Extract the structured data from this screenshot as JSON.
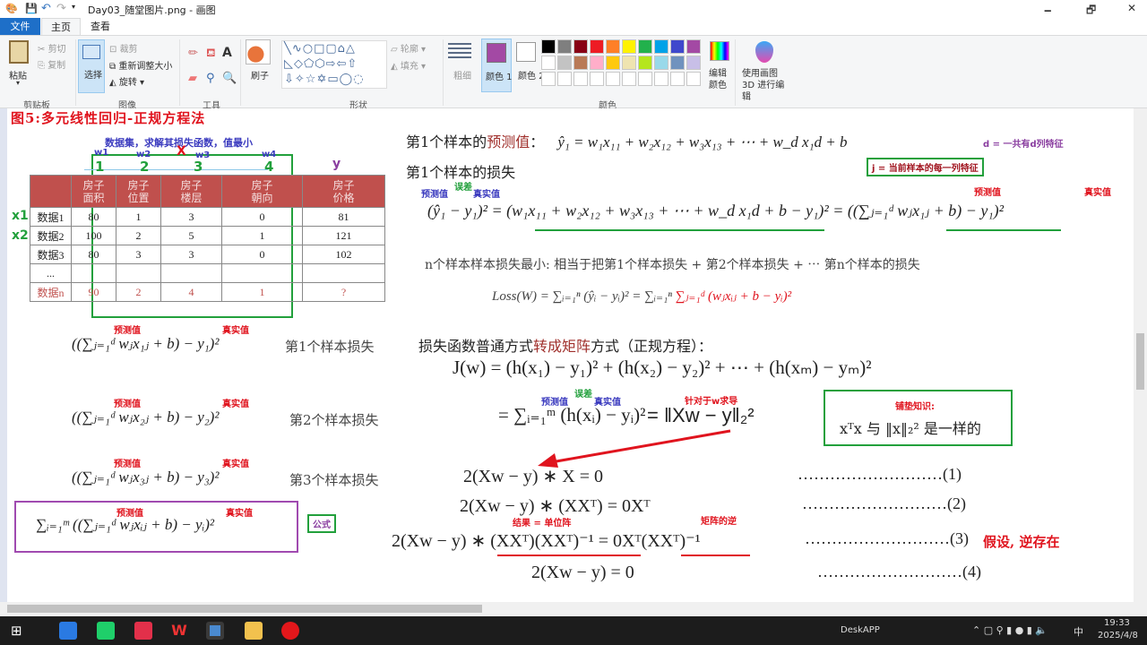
{
  "window": {
    "title": "Day03_随堂图片.png - 画图",
    "minimize": "🗕",
    "maximize": "🗗",
    "close": "✕"
  },
  "tabs": [
    {
      "label": "文件"
    },
    {
      "label": "主页"
    },
    {
      "label": "查看"
    }
  ],
  "ribbon": {
    "clipboard": {
      "paste": "粘贴",
      "cut": "剪切",
      "copy": "复制",
      "group": "剪贴板"
    },
    "image": {
      "select": "选择",
      "crop": "裁剪",
      "resize": "重新调整大小",
      "rotate": "旋转",
      "group": "图像"
    },
    "tools": {
      "group": "工具"
    },
    "brush": {
      "label": "刷子"
    },
    "shapes": {
      "outline": "轮廓",
      "fill": "填充",
      "group": "形状"
    },
    "size": {
      "label": "粗细"
    },
    "color1": {
      "label": "颜色 1",
      "value": "#a349a4"
    },
    "color2": {
      "label": "颜色 2",
      "value": "#ffffff"
    },
    "colors": {
      "group": "颜色",
      "edit": "编辑颜色",
      "row1": [
        "#000000",
        "#7f7f7f",
        "#880015",
        "#ed1c24",
        "#ff7f27",
        "#fff200",
        "#22b14c",
        "#00a2e8",
        "#3f48cc",
        "#a349a4"
      ],
      "row2": [
        "#ffffff",
        "#c3c3c3",
        "#b97a57",
        "#ffaec9",
        "#ffc90e",
        "#efe4b0",
        "#b5e61d",
        "#99d9ea",
        "#7092be",
        "#c8bfe7"
      ]
    },
    "paint3d": "使用画图 3D 进行编辑"
  },
  "doc": {
    "title": "图5:多元线性回归-正规方程法",
    "dataset_note": "数据集，求解其损失函数，值最小",
    "weights": [
      "w1",
      "w2",
      "w3",
      "w4"
    ],
    "col_nums": [
      "1",
      "2",
      "3",
      "4"
    ],
    "x_mark": "X",
    "y_label": "y",
    "row_labels": [
      "x1",
      "x2"
    ],
    "table": {
      "headers": [
        "",
        "房子\n面积",
        "房子\n位置",
        "房子\n楼层",
        "房子\n朝向",
        "房子\n价格"
      ],
      "rows": [
        [
          "数据1",
          "80",
          "1",
          "3",
          "0",
          "81"
        ],
        [
          "数据2",
          "100",
          "2",
          "5",
          "1",
          "121"
        ],
        [
          "数据3",
          "80",
          "3",
          "3",
          "0",
          "102"
        ],
        [
          "...",
          "",
          "",
          "",
          "",
          ""
        ],
        [
          "数据n",
          "90",
          "2",
          "4",
          "1",
          "?"
        ]
      ]
    },
    "pred": "预测值",
    "true": "真实值",
    "err": "误差",
    "left_eqs": [
      {
        "eq": "((∑ⱼ₌₁ᵈ wⱼx₁ⱼ + b)  − y₁)²",
        "note": "第1个样本损失"
      },
      {
        "eq": "((∑ⱼ₌₁ᵈ wⱼx₂ⱼ + b)  − y₂)²",
        "note": "第2个样本损失"
      },
      {
        "eq": "((∑ⱼ₌₁ᵈ wⱼx₃ⱼ + b)  − y₃)²",
        "note": "第3个样本损失"
      }
    ],
    "formula_eq": "∑ᵢ₌₁ᵐ ((∑ⱼ₌₁ᵈ wⱼxᵢⱼ + b)  − yᵢ)²",
    "formula_tag": "公式",
    "pred_line_label": "第1个样本的",
    "pred_line_label_red": "预测值",
    "pred_line_colon": "：",
    "pred_eq": "ŷ₁ = w₁x₁₁ + w₂x₁₂ + w₃x₁₃ + ⋯ + w_d x₁d  + b",
    "d_note": "d = 一共有d列特征",
    "j_note": "j = 当前样本的每一列特征",
    "loss1_label": "第1个样本的损失",
    "loss1_eq": "(ŷ₁ − y₁)² = (w₁x₁₁ + w₂x₁₂ + w₃x₁₃ + ⋯ + w_d x₁d + b − y₁)² = ((∑ⱼ₌₁ᵈ wⱼx₁ⱼ + b)  − y₁)²",
    "n_note": "n个样本样本损失最小: 相当于把第1个样本损失 + 第2个样本损失 +  ⋯ 第n个样本的损失",
    "loss_eq_a": "Loss(W) = ∑ᵢ₌₁ⁿ (ŷᵢ − yᵢ)² = ∑ᵢ₌₁ⁿ",
    "loss_eq_b": "∑ⱼ₌₁ᵈ (wⱼxᵢⱼ + b − yᵢ)²",
    "matrix_label_a": "损失函数普通方式",
    "matrix_label_b": "转成矩阵",
    "matrix_label_c": "方式（正规方程）：",
    "J_eq": "J(w) = (h(x₁) − y₁)² + (h(x₂) − y₂)² + ⋯ + (h(xₘ) − yₘ)²",
    "sum_eq": "= ∑ᵢ₌₁ᵐ (h(xᵢ) − yᵢ)²",
    "norm_eq": "= ‖Xw − y‖₂²",
    "deriv_note": "针对于w求导",
    "prior_title": "铺垫知识:",
    "prior_eq": "xᵀx 与 ‖x‖₂² 是一样的",
    "steps": [
      {
        "eq": "2(Xw − y) ∗ X =  0",
        "num": "………………………(1)"
      },
      {
        "eq": "2(Xw − y) ∗ (XXᵀ) =  0Xᵀ",
        "num": "………………………(2)"
      },
      {
        "eq": "2(Xw − y) ∗ (XXᵀ)(XXᵀ)⁻¹ =  0Xᵀ(XXᵀ)⁻¹",
        "num": "………………………(3)"
      },
      {
        "eq": "2(Xw − y) = 0",
        "num": "………………………(4)"
      }
    ],
    "identity_note": "结果 = 单位阵",
    "inverse_note": "矩阵的逆",
    "assume_note": "假设, 逆存在"
  },
  "taskbar": {
    "deskapp": "DeskAPP",
    "time": "19:33",
    "date": "2025/4/8",
    "ime": "中"
  }
}
